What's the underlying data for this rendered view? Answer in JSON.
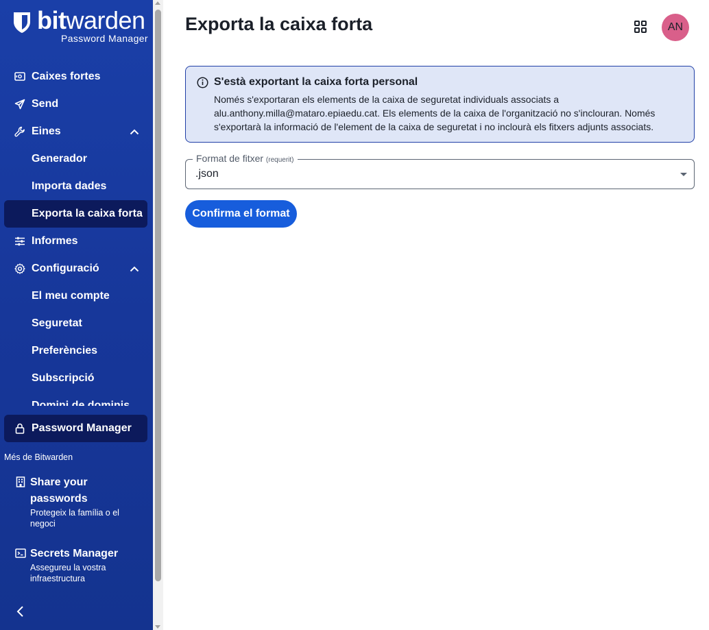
{
  "brand": {
    "name_bold": "bit",
    "name_regular": "warden",
    "subtitle": "Password Manager"
  },
  "sidebar": {
    "items": [
      {
        "label": "Caixes fortes",
        "icon": "vault-icon"
      },
      {
        "label": "Send",
        "icon": "send-icon"
      },
      {
        "label": "Eines",
        "icon": "wrench-icon",
        "expanded": true
      },
      {
        "label": "Generador"
      },
      {
        "label": "Importa dades"
      },
      {
        "label": "Exporta la caixa forta",
        "active": true
      },
      {
        "label": "Informes",
        "icon": "sliders-icon"
      },
      {
        "label": "Configuració",
        "icon": "gear-icon",
        "expanded": true
      },
      {
        "label": "El meu compte"
      },
      {
        "label": "Seguretat"
      },
      {
        "label": "Preferències"
      },
      {
        "label": "Subscripció"
      },
      {
        "label": "Domini de dominis"
      }
    ],
    "password_manager": "Password Manager",
    "more_label": "Més de Bitwarden",
    "products": [
      {
        "title": "Share your passwords",
        "desc": "Protegeix la família o el negoci",
        "icon": "building-icon"
      },
      {
        "title": "Secrets Manager",
        "desc": "Assegureu la vostra infraestructura",
        "icon": "terminal-icon"
      }
    ]
  },
  "header": {
    "title": "Exporta la caixa forta",
    "avatar_initials": "AN",
    "avatar_color": "#d95f8a"
  },
  "callout": {
    "title": "S'està exportant la caixa forta personal",
    "body": "Només s'exportaran els elements de la caixa de seguretat individuals associats a alu.anthony.milla@mataro.epiaedu.cat. Els elements de la caixa de l'organització no s'inclouran. Només s'exportarà la informació de l'element de la caixa de seguretat i no inclourà els fitxers adjunts associats."
  },
  "form": {
    "format_label": "Format de fitxer",
    "required_label": "(requerit)",
    "format_value": ".json",
    "submit_label": "Confirma el format"
  },
  "colors": {
    "sidebar": "#1a3fa8",
    "active_item": "#0c1a5c",
    "primary": "#175ddc",
    "callout_bg": "#dfe6f7"
  }
}
